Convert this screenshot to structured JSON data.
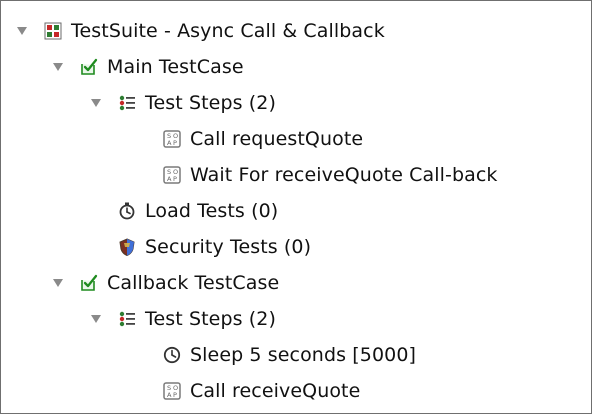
{
  "tree": {
    "nodes": [
      {
        "label": "TestSuite - Async Call & Callback"
      },
      {
        "label": "Main TestCase"
      },
      {
        "label": "Test Steps (2)"
      },
      {
        "label": "Call requestQuote"
      },
      {
        "label": "Wait For receiveQuote Call-back"
      },
      {
        "label": "Load Tests (0)"
      },
      {
        "label": "Security Tests (0)"
      },
      {
        "label": "Callback TestCase"
      },
      {
        "label": "Test Steps (2)"
      },
      {
        "label": "Sleep 5 seconds [5000]"
      },
      {
        "label": "Call receiveQuote"
      }
    ]
  },
  "icons": {
    "expand": "triangle-down-icon",
    "suite": "testsuite-grid-icon",
    "testcase": "checked-testcase-icon",
    "steps": "list-steps-icon",
    "soap": "soap-icon",
    "load": "stopwatch-icon",
    "security": "shield-icon",
    "sleep": "clock-icon"
  },
  "colors": {
    "border": "#6f6f6f",
    "text": "#111111",
    "triangle": "#8a8a8a",
    "suiteRed": "#c62828",
    "suiteGreen": "#2e7d32",
    "testcaseGreen": "#1f8b1f",
    "soapGray": "#7a7a7a"
  }
}
